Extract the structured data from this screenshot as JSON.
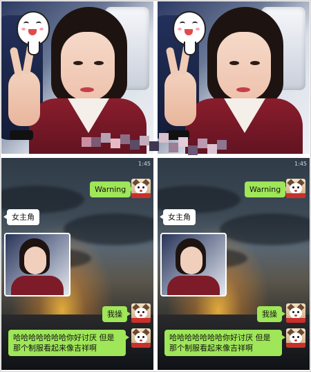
{
  "panels": [
    {
      "status_time": "1:45",
      "messages": {
        "sent_1": "Warning",
        "received_1": "女主角",
        "sent_2": "我操",
        "sent_3": "哈哈哈哈哈哈哈你好讨厌 但是那个制服看起来像吉祥啊"
      }
    },
    {
      "status_time": "1:45",
      "messages": {
        "sent_1": "Warning",
        "received_1": "女主角",
        "sent_2": "我操",
        "sent_3": "哈哈哈哈哈哈哈你好讨厌 但是那个制服看起来像吉祥啊"
      }
    }
  ],
  "colors": {
    "sent_bubble": "#9fe658",
    "received_bubble": "#ffffff",
    "uniform": "#8a1d2c"
  },
  "icons": {
    "avatar": "cat-avatar-icon",
    "sticker": "mascot-sticker-icon"
  }
}
